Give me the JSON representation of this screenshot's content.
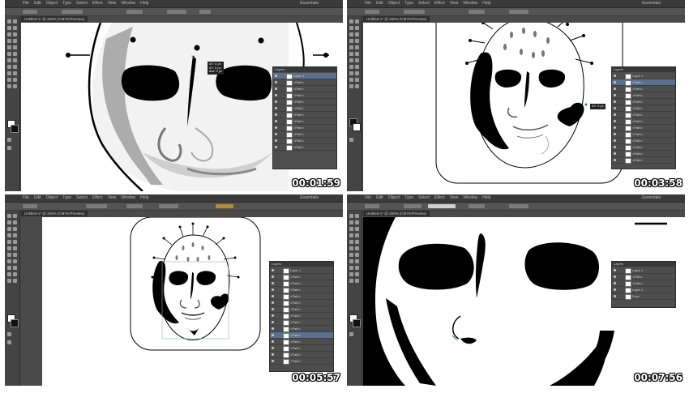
{
  "menu": [
    "File",
    "Edit",
    "Object",
    "Type",
    "Select",
    "Effect",
    "View",
    "Window",
    "Help"
  ],
  "workspace_label": "Essentials",
  "document_tab": "Untitled-1* @ 200% (CMYK/Preview)",
  "layers_panel_title": "Layers",
  "layer_rows": [
    "Layer 1",
    "<Path>",
    "<Path>",
    "<Path>",
    "<Path>",
    "<Path>",
    "<Path>",
    "<Path>",
    "<Path>",
    "<Path>",
    "<Path>",
    "<Path>",
    "<Path>",
    "<Path>",
    "<Path>",
    "<Path>"
  ],
  "layer_rows_short": [
    "Layer 1",
    "<Path>",
    "<Path>",
    "Layer 2",
    "Face"
  ],
  "panes": [
    {
      "timestamp": "00:01:59",
      "tooltip": "dX: 0 px\ndY: 0 px\ndist: 0 px"
    },
    {
      "timestamp": "00:03:58",
      "tooltip": "dX: 0 px"
    },
    {
      "timestamp": "00:05:57"
    },
    {
      "timestamp": "00:07:56"
    }
  ],
  "colors": {
    "ui_dark": "#4a4a4a",
    "menubar": "#3a3a3a",
    "canvas": "#ffffff",
    "artwork": "#000000",
    "selection": "#5b6f8f",
    "timestamp_text": "#ffffff"
  }
}
